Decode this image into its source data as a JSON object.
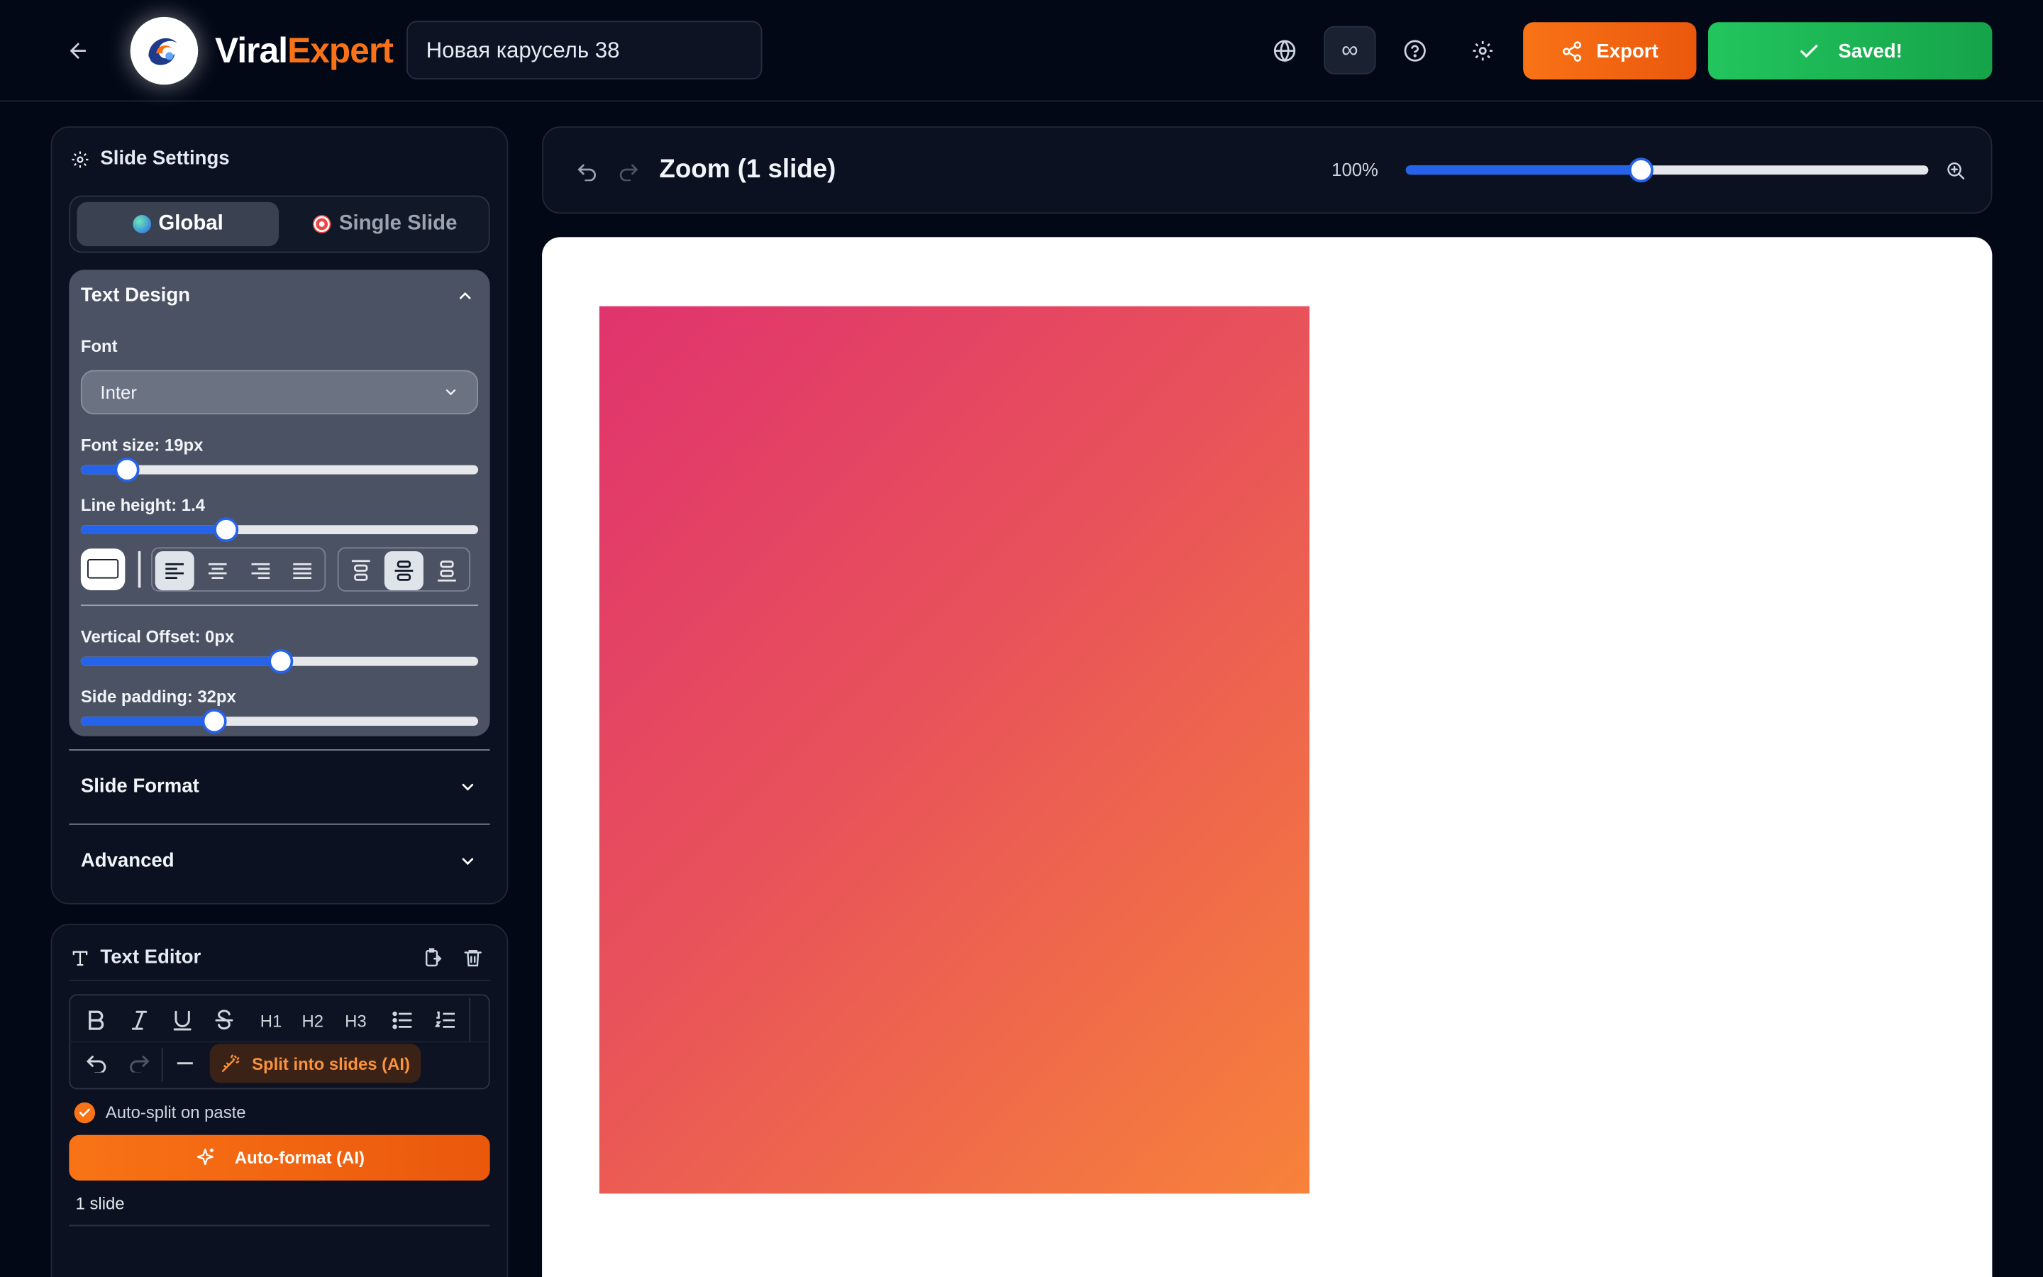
{
  "header": {
    "back_icon": "arrow-left-icon",
    "brand_part1": "Viral",
    "brand_part2": "Expert",
    "project_title": "Новая карусель 38",
    "icons": [
      "globe-icon",
      "infinity-icon",
      "help-circle-icon",
      "settings-gear-icon"
    ],
    "loop_symbol": "∞",
    "export_label": "Export",
    "saved_label": "Saved!"
  },
  "slide_settings": {
    "title": "Slide Settings",
    "scope_tabs": [
      {
        "label": "Global",
        "active": true
      },
      {
        "label": "Single Slide",
        "active": false
      }
    ],
    "text_design": {
      "title": "Text Design",
      "font_label": "Font",
      "font_value": "Inter",
      "font_size_label": "Font size: 19px",
      "font_size_fraction": 0.115,
      "line_height_label": "Line height: 1.4",
      "line_height_fraction": 0.365,
      "align_options": [
        "left",
        "center",
        "right",
        "justify"
      ],
      "align_selected": "left",
      "valign_options": [
        "top",
        "middle",
        "bottom"
      ],
      "valign_selected": "middle",
      "vertical_offset_label": "Vertical Offset: 0px",
      "vertical_offset_fraction": 0.5,
      "side_padding_label": "Side padding: 32px",
      "side_padding_fraction": 0.333
    },
    "sections": [
      "Slide Format",
      "Advanced"
    ]
  },
  "text_editor": {
    "title": "Text Editor",
    "toolbar_headings": [
      "H1",
      "H2",
      "H3"
    ],
    "split_label": "Split into slides (AI)",
    "auto_split_label": "Auto-split on paste",
    "auto_split_checked": true,
    "autoformat_label": "Auto-format (AI)",
    "slide_count": "1 slide"
  },
  "zoom": {
    "label": "Zoom (1 slide)",
    "percent": "100%",
    "fraction": 0.448
  },
  "colors": {
    "accent_orange": "#f97316",
    "accent_green": "#22c55e",
    "slider_blue": "#2563eb",
    "slide_gradient": [
      "#e0336e",
      "#f7823a"
    ]
  }
}
